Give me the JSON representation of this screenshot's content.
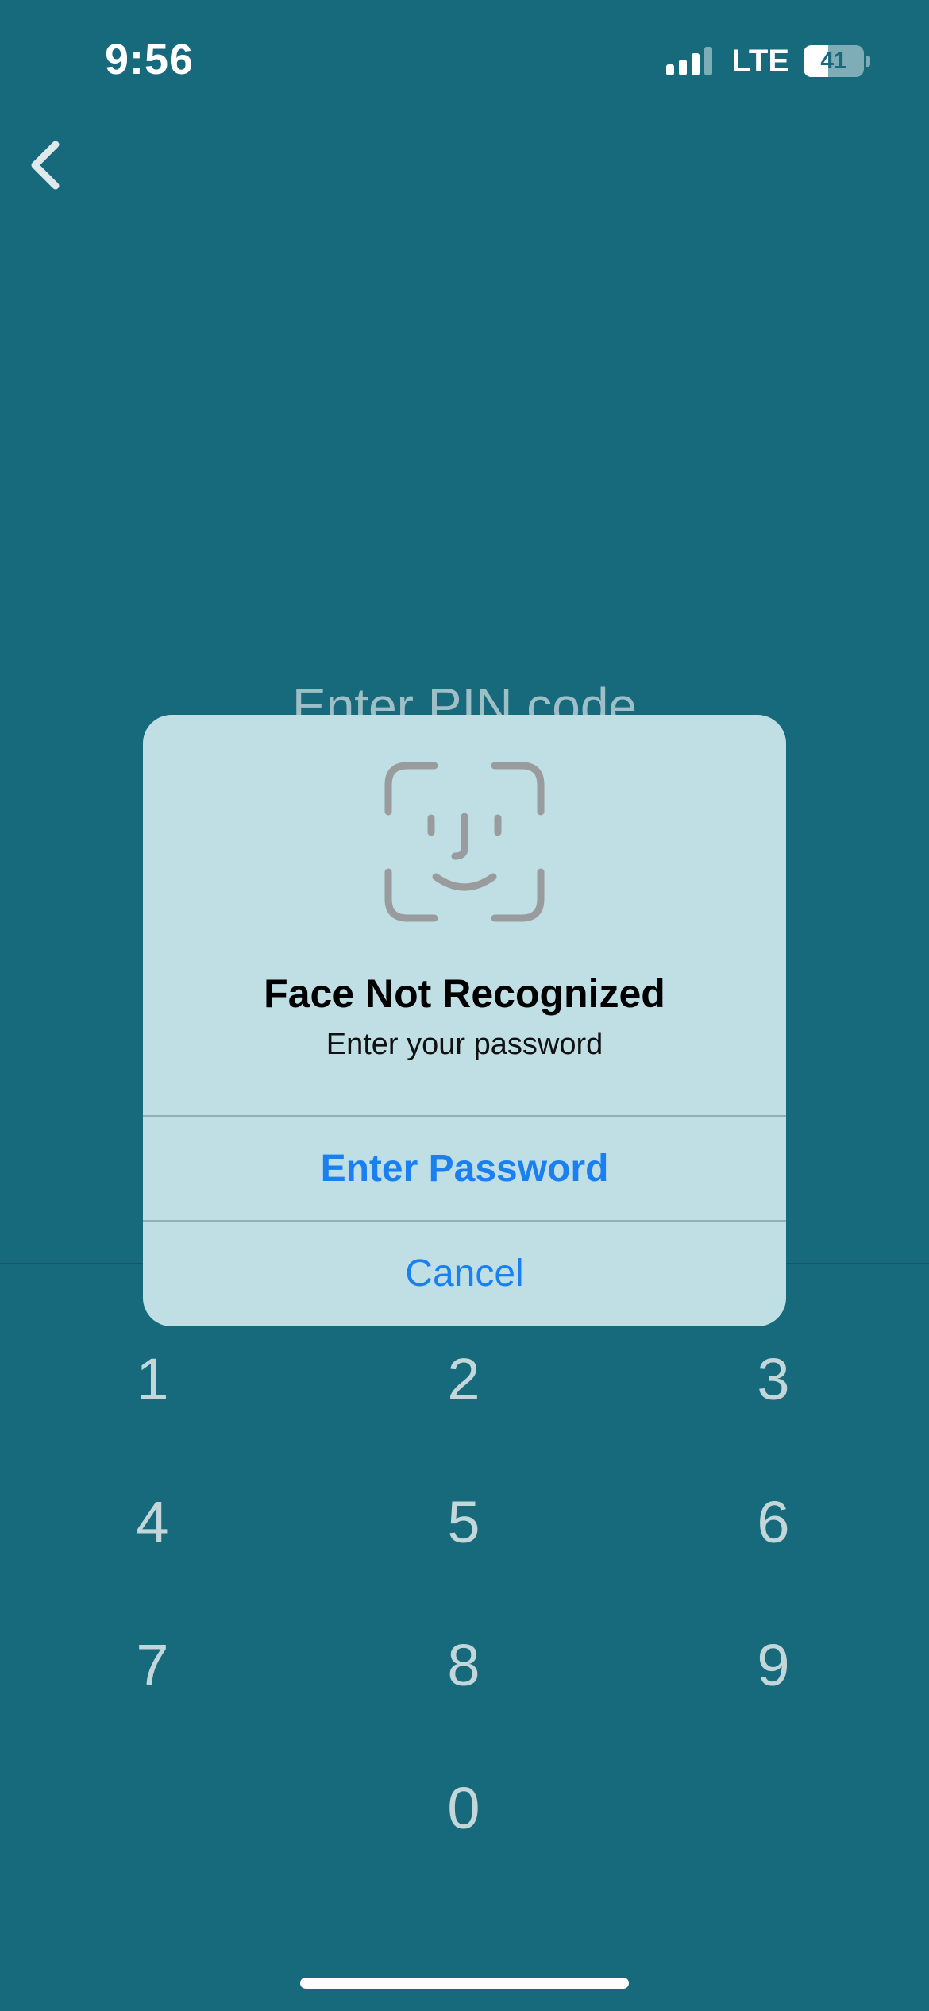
{
  "status_bar": {
    "time": "9:56",
    "network": "LTE",
    "battery_level": "41",
    "battery_fraction": 0.41
  },
  "nav": {
    "back_icon": "chevron-left-icon"
  },
  "screen": {
    "title": "Enter PIN code"
  },
  "keypad": {
    "keys": [
      "1",
      "2",
      "3",
      "4",
      "5",
      "6",
      "7",
      "8",
      "9",
      "0"
    ]
  },
  "alert": {
    "icon": "face-id-icon",
    "title": "Face Not Recognized",
    "message": "Enter your password",
    "primary_button": "Enter Password",
    "cancel_button": "Cancel"
  },
  "colors": {
    "background": "#176a7c",
    "alert_background": "#bfdfe5",
    "button_text": "#1a7ff0"
  }
}
